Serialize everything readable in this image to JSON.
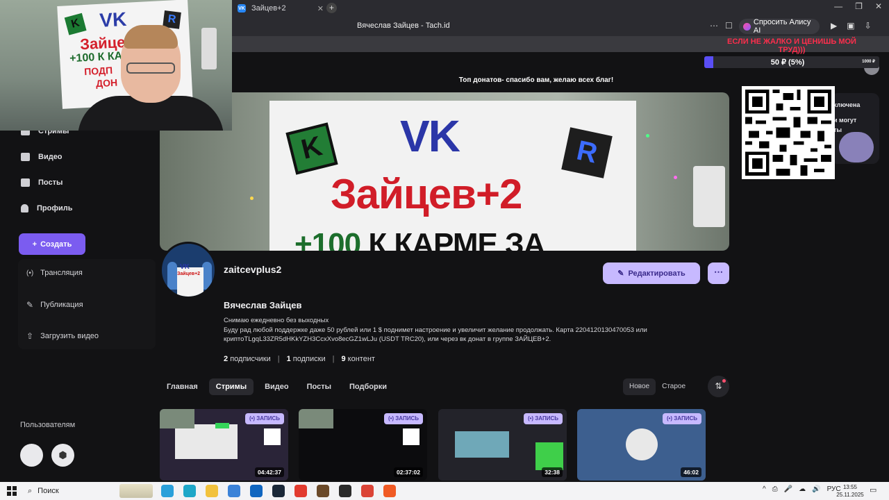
{
  "browser": {
    "tab_title": "Зайцев+2",
    "tab_favicon": "VK",
    "tab_close": "✕",
    "new_tab": "+",
    "page_title": "Вячеслав Зайцев - Tach.id",
    "alice_label": "Спросить Алису AI",
    "window_controls": {
      "minimize": "—",
      "restore": "❐",
      "close": "✕"
    }
  },
  "sidebar": {
    "items": [
      {
        "label": "Стримы",
        "icon": "broadcast-icon"
      },
      {
        "label": "Видео",
        "icon": "video-icon"
      },
      {
        "label": "Посты",
        "icon": "posts-icon"
      },
      {
        "label": "Профиль",
        "icon": "user-icon"
      }
    ],
    "create_label": "Создать",
    "create_menu": [
      {
        "label": "Трансляция",
        "icon": "live-icon",
        "glyph": "(•)"
      },
      {
        "label": "Публикация",
        "icon": "edit-icon",
        "glyph": "✎"
      },
      {
        "label": "Загрузить видео",
        "icon": "upload-icon",
        "glyph": "⇧"
      }
    ],
    "users_label": "Пользователям",
    "store_apple": "",
    "store_android": "⬢"
  },
  "webcam": {
    "poster_vk": "VK",
    "poster_k": "K",
    "poster_r": "R",
    "poster_line1": "Зайцев+2",
    "poster_line2": "+100 К КА",
    "poster_line3": "ПОДП",
    "poster_line4": "ДОН"
  },
  "banner": {
    "vk": "VK",
    "k": "K",
    "r": "R",
    "line1": "Зайцев+2",
    "line2_prefix": "+100",
    "line2_rest": " К КАРМЕ ЗА"
  },
  "profile": {
    "avatar_vk": "VK",
    "avatar_text": "Зайцев+2",
    "username": "zaitcevplus2",
    "edit_label": "Редактировать",
    "more_label": "⋯",
    "full_name": "Вячеслав Зайцев",
    "bio_line1": "Снимаю ежедневно без выходных",
    "bio_line2": "Буду рад любой поддержке даже 50 рублей или 1 $ поднимет настроение и увеличит желание продолжать. Карта 2204120130470053 или",
    "bio_line3": "криптоTLgqL33ZR5dHKkYZH3CcxXvo8ecGZ1wLJu (USDT TRC20), или через вк донат в группе ЗАЙЦЕВ+2.",
    "stats": [
      {
        "value": "2",
        "label": "подписчики"
      },
      {
        "value": "1",
        "label": "подписки"
      },
      {
        "value": "9",
        "label": "контент"
      }
    ],
    "stat_separator": "|"
  },
  "tabs": [
    "Главная",
    "Стримы",
    "Видео",
    "Посты",
    "Подборки"
  ],
  "active_tab": "Стримы",
  "sort": {
    "new": "Новое",
    "old": "Старое"
  },
  "filter_icon": "⇅",
  "videos": [
    {
      "badge": "(•) ЗАПИСЬ",
      "duration": "04:42:37",
      "bg": "#2a2438"
    },
    {
      "badge": "(•) ЗАПИСЬ",
      "duration": "02:37:02",
      "bg": "#0c0c0e"
    },
    {
      "badge": "(•) ЗАПИСЬ",
      "duration": "32:38",
      "bg": "#23232a"
    },
    {
      "badge": "(•) ЗАПИСЬ",
      "duration": "46:02",
      "bg": "#3d5f8f"
    }
  ],
  "overlay": {
    "donate_text": "ЕСЛИ НЕ ЖАЛКО И ЦЕНИШЬ МОЙ ТРУД)))",
    "donate_amount": "50 ₽ (5%)",
    "donate_progress_percent": 5,
    "donate_goal": "1000 ₽",
    "top_donors": "Топ донатов- спасибо вам, желаю всех благ!",
    "side_line1": "ключена",
    "side_line2": "и могут",
    "side_line3": "ты"
  },
  "taskbar": {
    "search_label": "Поиск",
    "search_icon": "⌕",
    "lang": "РУС",
    "time": "13:55",
    "date": "25.11.2025",
    "tray_icons": [
      "^",
      "⎙",
      "🎤",
      "☁",
      "🔊"
    ],
    "notification_icon": "▭",
    "apps": [
      {
        "name": "telegram-icon",
        "color": "#2aa0da"
      },
      {
        "name": "edge-icon",
        "color": "#1ea7c8"
      },
      {
        "name": "explorer-icon",
        "color": "#f2c23d"
      },
      {
        "name": "store-icon",
        "color": "#3b82d8"
      },
      {
        "name": "outlook-icon",
        "color": "#1066c0"
      },
      {
        "name": "steam-icon",
        "color": "#1b2838"
      },
      {
        "name": "yandex-browser-icon",
        "color": "#e23b2f"
      },
      {
        "name": "app-photo-icon",
        "color": "#6b4a2a"
      },
      {
        "name": "obs-icon",
        "color": "#2b2b2b"
      },
      {
        "name": "chrome-icon",
        "color": "#db4437"
      },
      {
        "name": "brave-icon",
        "color": "#f05a24"
      }
    ]
  }
}
